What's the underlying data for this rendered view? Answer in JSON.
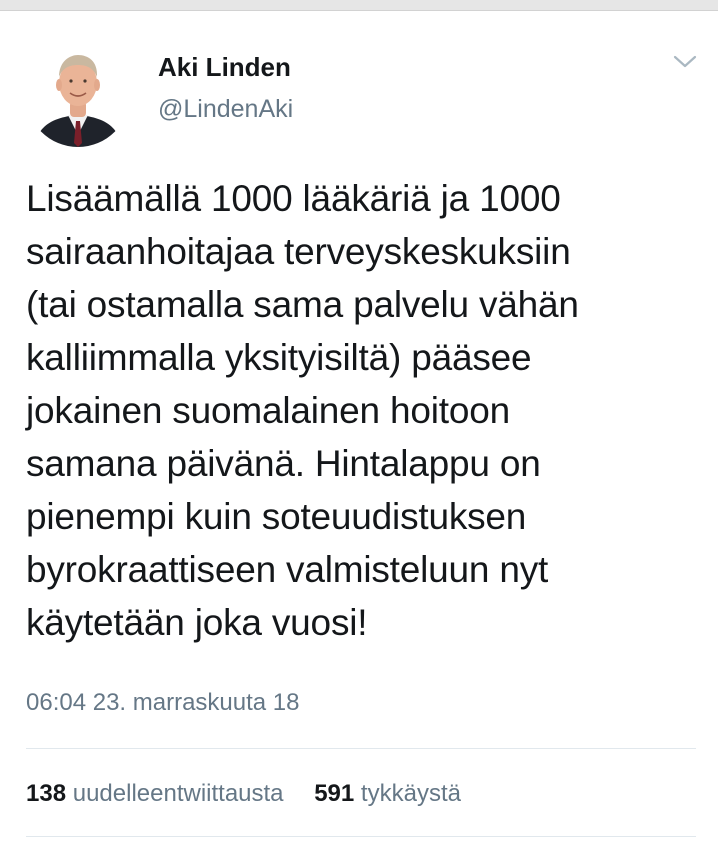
{
  "tweet": {
    "author": {
      "name": "Aki Linden",
      "handle": "@LindenAki",
      "avatar_icon": "person-avatar-photo"
    },
    "menu_icon": "chevron-down-icon",
    "text_lines": [
      "Lisäämällä 1000 lääkäriä ja 1000",
      "sairaanhoitajaa terveyskeskuksiin",
      "(tai ostamalla sama palvelu vähän",
      "kalliimmalla yksityisiltä) pääsee",
      "jokainen suomalainen hoitoon",
      "samana päivänä. Hintalappu on",
      "pienempi kuin soteuudistuksen",
      "byrokraattiseen valmisteluun nyt",
      "käytetään joka vuosi!"
    ],
    "timestamp": "06:04 23. marraskuuta 18",
    "stats": {
      "retweets_count": "138",
      "retweets_label": "uudelleentwiittausta",
      "likes_count": "591",
      "likes_label": "tykkäystä"
    }
  },
  "colors": {
    "text_primary": "#14171a",
    "text_secondary": "#657786",
    "divider": "#e1e8ed"
  }
}
